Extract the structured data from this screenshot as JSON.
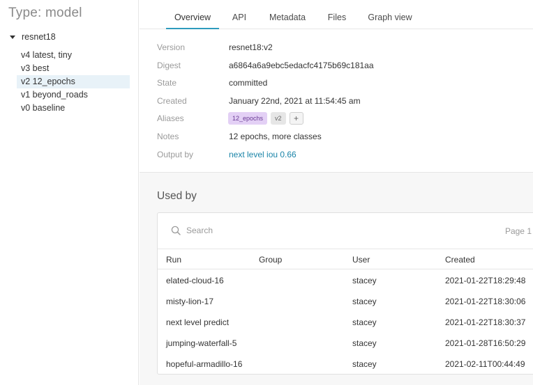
{
  "sidebar": {
    "title": "Type: model",
    "root": "resnet18",
    "versions": [
      {
        "label": "v4 latest, tiny"
      },
      {
        "label": "v3 best"
      },
      {
        "label": "v2 12_epochs",
        "selected": true
      },
      {
        "label": "v1 beyond_roads"
      },
      {
        "label": "v0 baseline"
      }
    ]
  },
  "tabs": [
    "Overview",
    "API",
    "Metadata",
    "Files",
    "Graph view"
  ],
  "active_tab": "Overview",
  "details": {
    "version_label": "Version",
    "version": "resnet18:v2",
    "digest_label": "Digest",
    "digest": "a6864a6a9ebc5edacfc4175b69c181aa",
    "state_label": "State",
    "state": "committed",
    "created_label": "Created",
    "created": "January 22nd, 2021 at 11:54:45 am",
    "aliases_label": "Aliases",
    "aliases": [
      "12_epochs",
      "v2"
    ],
    "add_alias": "+",
    "notes_label": "Notes",
    "notes": "12 epochs, more classes",
    "output_label": "Output by",
    "output_by": "next level iou 0.66"
  },
  "used_by": {
    "title": "Used by",
    "search_placeholder": "Search",
    "page": "Page 1",
    "columns": [
      "Run",
      "Group",
      "User",
      "Created"
    ],
    "rows": [
      {
        "run": "elated-cloud-16",
        "group": "",
        "user": "stacey",
        "created": "2021-01-22T18:29:48"
      },
      {
        "run": "misty-lion-17",
        "group": "",
        "user": "stacey",
        "created": "2021-01-22T18:30:06"
      },
      {
        "run": "next level predict",
        "group": "",
        "user": "stacey",
        "created": "2021-01-22T18:30:37"
      },
      {
        "run": "jumping-waterfall-5",
        "group": "",
        "user": "stacey",
        "created": "2021-01-28T16:50:29"
      },
      {
        "run": "hopeful-armadillo-16",
        "group": "",
        "user": "stacey",
        "created": "2021-02-11T00:44:49"
      }
    ]
  },
  "colors": {
    "accent": "#2e9bbd",
    "link": "#1a84a8",
    "selected_bg": "#e8f2f8",
    "alias_purple": "#e3d0f5"
  }
}
